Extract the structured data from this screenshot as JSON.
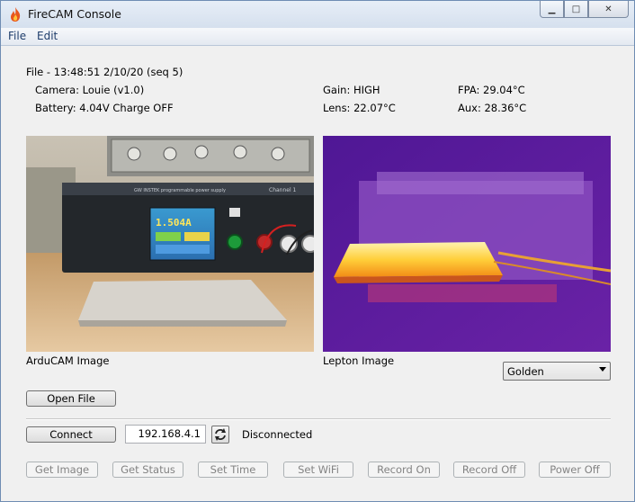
{
  "window": {
    "title": "FireCAM Console",
    "min_glyph": "▁",
    "max_glyph": "□",
    "close_glyph": "✕"
  },
  "menu": {
    "items": [
      "File",
      "Edit"
    ]
  },
  "info": {
    "file_line": "File - 13:48:51 2/10/20  (seq 5)",
    "camera": "Camera: Louie  (v1.0)",
    "battery": "Battery: 4.04V   Charge OFF",
    "gain": "Gain: HIGH",
    "lens": "Lens: 22.07°C",
    "fpa": "FPA: 29.04°C",
    "aux": "Aux: 28.36°C"
  },
  "images": {
    "arducam_label": "ArduCAM Image",
    "lepton_label": "Lepton Image",
    "psu_display": "1.504A",
    "psu_brand": "GW INSTEK programmable power supply",
    "psu_channel": "Channel 1"
  },
  "palette": {
    "selected": "Golden"
  },
  "buttons": {
    "open_file": "Open File",
    "connect": "Connect",
    "get_image": "Get Image",
    "get_status": "Get Status",
    "set_time": "Set Time",
    "set_wifi": "Set WiFi",
    "record_on": "Record On",
    "record_off": "Record Off",
    "power_off": "Power Off"
  },
  "connection": {
    "ip": "192.168.4.1",
    "status": "Disconnected"
  },
  "colors": {
    "accent": "#1e3d6b",
    "thermal_background": "#5a1fa0",
    "thermal_hot": "#ffe89a"
  }
}
